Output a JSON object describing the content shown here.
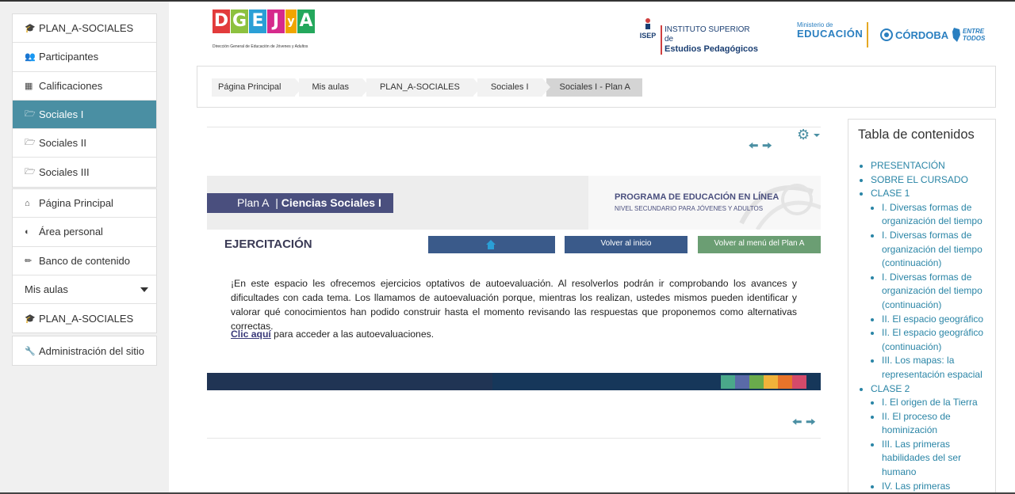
{
  "sidebar": {
    "course": [
      {
        "label": "PLAN_A-SOCIALES",
        "icon": "graduation-cap-icon"
      },
      {
        "label": "Participantes",
        "icon": "users-icon"
      },
      {
        "label": "Calificaciones",
        "icon": "table-icon"
      },
      {
        "label": "Sociales I",
        "icon": "folder-icon",
        "active": true
      },
      {
        "label": "Sociales II",
        "icon": "folder-icon"
      },
      {
        "label": "Sociales III",
        "icon": "folder-icon"
      }
    ],
    "site": [
      {
        "label": "Página Principal",
        "icon": "home-icon"
      },
      {
        "label": "Área personal",
        "icon": "dashboard-icon"
      },
      {
        "label": "Banco de contenido",
        "icon": "paintbrush-icon"
      },
      {
        "label": "Mis aulas",
        "icon": "caret-down-icon"
      },
      {
        "label": "PLAN_A-SOCIALES",
        "icon": "graduation-cap-icon"
      }
    ],
    "admin": {
      "label": "Administración del sitio",
      "icon": "wrench-icon"
    }
  },
  "header": {
    "logo_letters": [
      "D",
      "G",
      "E",
      "J",
      "y",
      "A"
    ],
    "logo_colors": [
      "#e23b3b",
      "#8dc13f",
      "#2a9fd6",
      "#d62a8c",
      "#f0a500",
      "#24a85c"
    ],
    "logo_subtitle": "Dirección General de Educación de Jóvenes y Adultos",
    "isep_mark": "ISEP",
    "isep_line1": "INSTITUTO SUPERIOR de",
    "isep_line2": "Estudios Pedagógicos",
    "ministerio_line1": "Ministerio de",
    "ministerio_line2": "EDUCACIÓN",
    "cordoba": "CÓRDOBA",
    "entre_line1": "ENTRE",
    "entre_line2": "TODOS"
  },
  "breadcrumb": [
    "Página Principal",
    "Mis aulas",
    "PLAN_A-SOCIALES",
    "Sociales I",
    "Sociales I - Plan A"
  ],
  "content": {
    "plan_prefix": "Plan A",
    "plan_title": "Ciencias Sociales I",
    "program_line1": "PROGRAMA DE EDUCACIÓN EN LÍNEA",
    "program_line2": "NIVEL SECUNDARIO PARA JÓVENES Y ADULTOS",
    "section_title": "EJERCITACIÓN",
    "btn_volver_inicio": "Volver al inicio",
    "btn_volver_menu": "Volver al menú del Plan A",
    "paragraph": "¡En este espacio les ofrecemos ejercicios optativos de autoevaluación. Al resolverlos podrán ir comprobando los avances y dificultades con cada tema. Los llamamos de autoevaluación porque, mientras los realizan, ustedes mismos pueden identificar y valorar qué conocimientos han podido construir hasta el momento revisando las respuestas que proponemos como alternativas correctas.",
    "clic_link": "Clic aquí",
    "clic_rest": " para acceder a las autoevaluaciones.",
    "footer_swatches": [
      "#4aa88a",
      "#5a6aa8",
      "#6aab4c",
      "#f0b23a",
      "#e8742a",
      "#d44a6a"
    ]
  },
  "toc": {
    "title": "Tabla de contenidos",
    "presentacion": "PRESENTACIÓN",
    "sobre": "SOBRE EL CURSADO",
    "clase1": "CLASE 1",
    "clase1_items": [
      "I. Diversas formas de organización del tiempo",
      "I. Diversas formas de organización del tiempo (continuación)",
      "I. Diversas formas de organización del tiempo (continuación)",
      "II. El espacio geográfico",
      "II. El espacio geográfico (continuación)",
      "III. Los mapas: la representación espacial"
    ],
    "clase2": "CLASE 2",
    "clase2_items": [
      "I. El origen de la Tierra",
      "II. El proceso de hominización",
      "III. Las primeras habilidades del ser humano",
      "IV. Las primeras"
    ]
  }
}
